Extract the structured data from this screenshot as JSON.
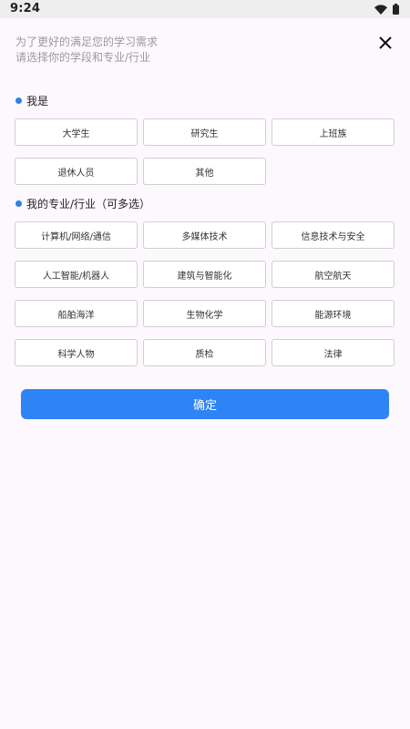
{
  "status_bar": {
    "time": "9:24",
    "icons": [
      "wifi-icon",
      "battery-icon"
    ]
  },
  "header": {
    "line1": "为了更好的满足您的学习需求",
    "line2": "请选择你的学段和专业/行业",
    "close_icon": "close-icon"
  },
  "identity": {
    "title": "我是",
    "options": [
      "大学生",
      "研究生",
      "上班族",
      "退休人员",
      "其他"
    ]
  },
  "major": {
    "title": "我的专业/行业（可多选）",
    "options": [
      "计算机/网络/通信",
      "多媒体技术",
      "信息技术与安全",
      "人工智能/机器人",
      "建筑与智能化",
      "航空航天",
      "船舶海洋",
      "生物化学",
      "能源环境",
      "科学人物",
      "质检",
      "法律"
    ]
  },
  "confirm_label": "确定",
  "colors": {
    "accent": "#2e84f5",
    "background": "#fdf8fd",
    "hint_text": "#9a9a9a"
  }
}
